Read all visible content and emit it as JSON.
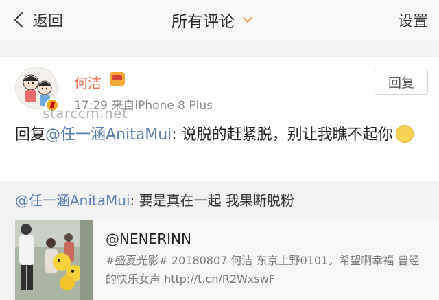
{
  "navbar": {
    "back_label": "返回",
    "title": "所有评论",
    "settings_label": "设置"
  },
  "comment": {
    "username": "何洁",
    "timestamp": "17:29  来自iPhone 8 Plus",
    "reply_label": "回复",
    "text_prefix": "回复",
    "mention": "@任一涵AnitaMui",
    "text_body": ": 说脱的赶紧脱，别让我瞧不起你",
    "emoji": "smile-emoji"
  },
  "watermark": "starccm.net",
  "quote": {
    "mention": "@任一涵AnitaMui",
    "text": ": 要是真在一起 我果断脱粉"
  },
  "link_card": {
    "title": "@NENERINN",
    "description": "#盛夏光影# 20180807  何洁 东京上野0101。希望啊幸福 曾经的快乐女声 http://t.cn/R2WxswF"
  },
  "colors": {
    "username": "#eb7350",
    "mention": "#5b7fb0",
    "caret": "#e8a33d"
  }
}
